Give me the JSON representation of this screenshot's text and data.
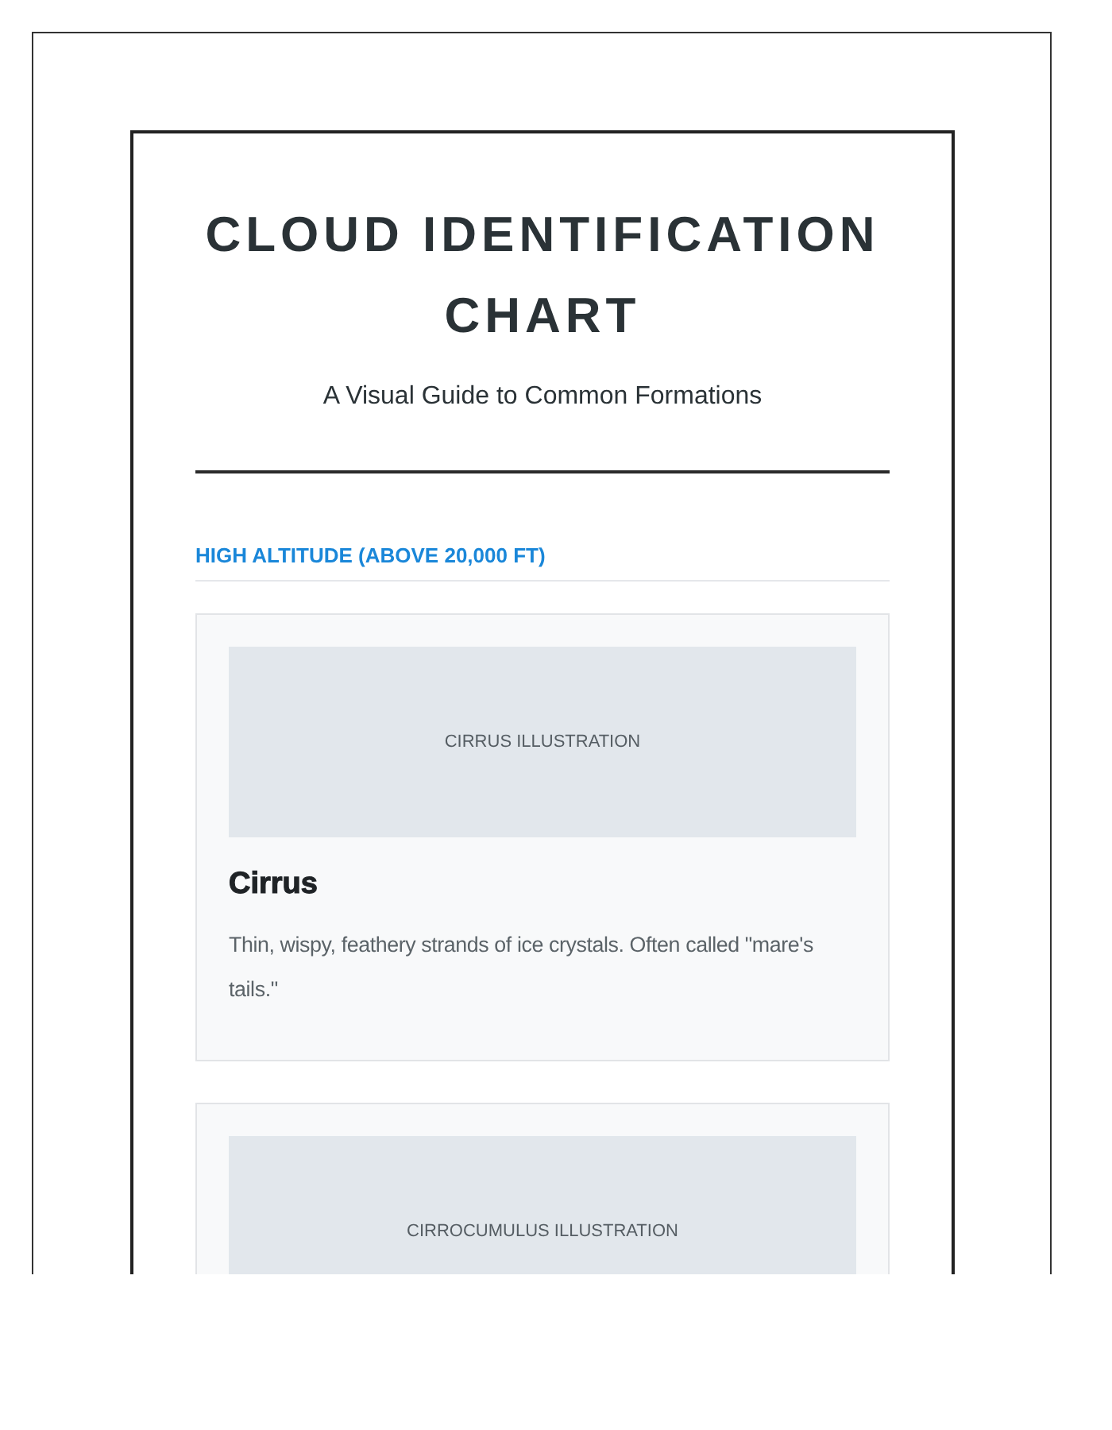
{
  "title": "CLOUD IDENTIFICATION CHART",
  "subtitle": "A Visual Guide to Common Formations",
  "sections": [
    {
      "heading": "HIGH ALTITUDE (ABOVE 20,000 FT)",
      "clouds": [
        {
          "illustration_label": "CIRRUS ILLUSTRATION",
          "name": "Cirrus",
          "description": "Thin, wispy, feathery strands of ice crystals. Often called \"mare's tails.\""
        },
        {
          "illustration_label": "CIRROCUMULUS ILLUSTRATION"
        }
      ]
    }
  ]
}
